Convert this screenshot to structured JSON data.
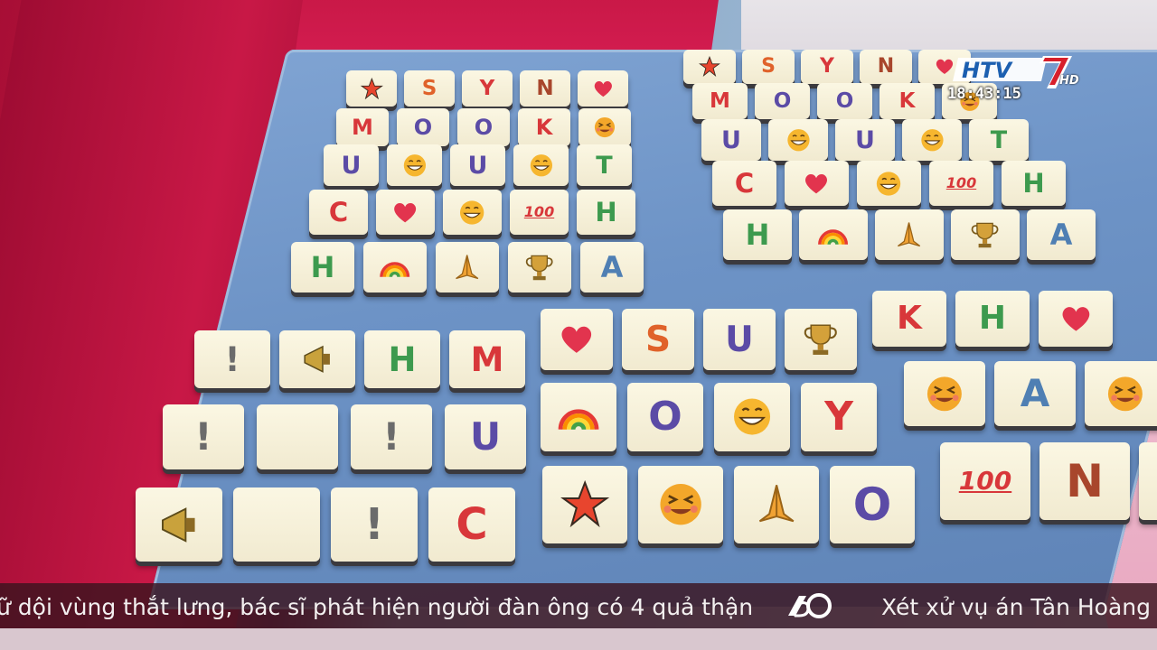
{
  "broadcast": {
    "channel_logo_text": "HTV7",
    "hd_label": "HD",
    "clock": "18:43:15"
  },
  "ticker": {
    "left_text": "ữ dội vùng thắt lưng, bác sĩ phát hiện người đàn ông có 4 quả thận",
    "right_text": "Xét xử vụ án Tân Hoàng M",
    "separator_logo": "60-logo"
  },
  "tiles": {
    "top_left": [
      [
        "star-icon",
        "S",
        "Y",
        "N",
        "heart-icon"
      ],
      [
        "M",
        "O",
        "O",
        "K",
        "grin-squint-icon"
      ],
      [
        "U",
        "grin-icon",
        "U",
        "grin-icon",
        "T"
      ],
      [
        "C",
        "heart-icon",
        "grin-icon",
        "100",
        "H"
      ],
      [
        "H",
        "rainbow-icon",
        "pray-icon",
        "trophy-icon",
        "A"
      ]
    ],
    "top_right": [
      [
        "star-icon",
        "S",
        "Y",
        "N",
        "heart-icon"
      ],
      [
        "M",
        "O",
        "O",
        "K",
        "grin-squint-icon"
      ],
      [
        "U",
        "grin-icon",
        "U",
        "grin-icon",
        "T"
      ],
      [
        "C",
        "heart-icon",
        "grin-icon",
        "100",
        "H"
      ],
      [
        "H",
        "rainbow-icon",
        "pray-icon",
        "trophy-icon",
        "A"
      ]
    ],
    "bottom_left": [
      [
        "!",
        "megaphone-icon",
        "H",
        "M"
      ],
      [
        "!",
        "",
        "!",
        "U"
      ],
      [
        "megaphone-icon",
        "",
        "!",
        "C"
      ]
    ],
    "bottom_mid": [
      [
        "heart-icon",
        "S",
        "U",
        "trophy-icon"
      ],
      [
        "rainbow-icon",
        "O",
        "grin-icon",
        "Y"
      ],
      [
        "star-icon",
        "grin-squint-icon",
        "pray-icon",
        "O"
      ]
    ],
    "bottom_right": [
      [
        "K",
        "H",
        "heart-icon"
      ],
      [
        "grin-squint-icon",
        "A",
        "grin-squint-icon"
      ],
      [
        "100",
        "N",
        ""
      ]
    ]
  },
  "colors": {
    "tile_face": "#f7f1da",
    "ticker_bg": "#3a141e",
    "board_blue": "#6d93c6",
    "curtain_red": "#c81846"
  }
}
